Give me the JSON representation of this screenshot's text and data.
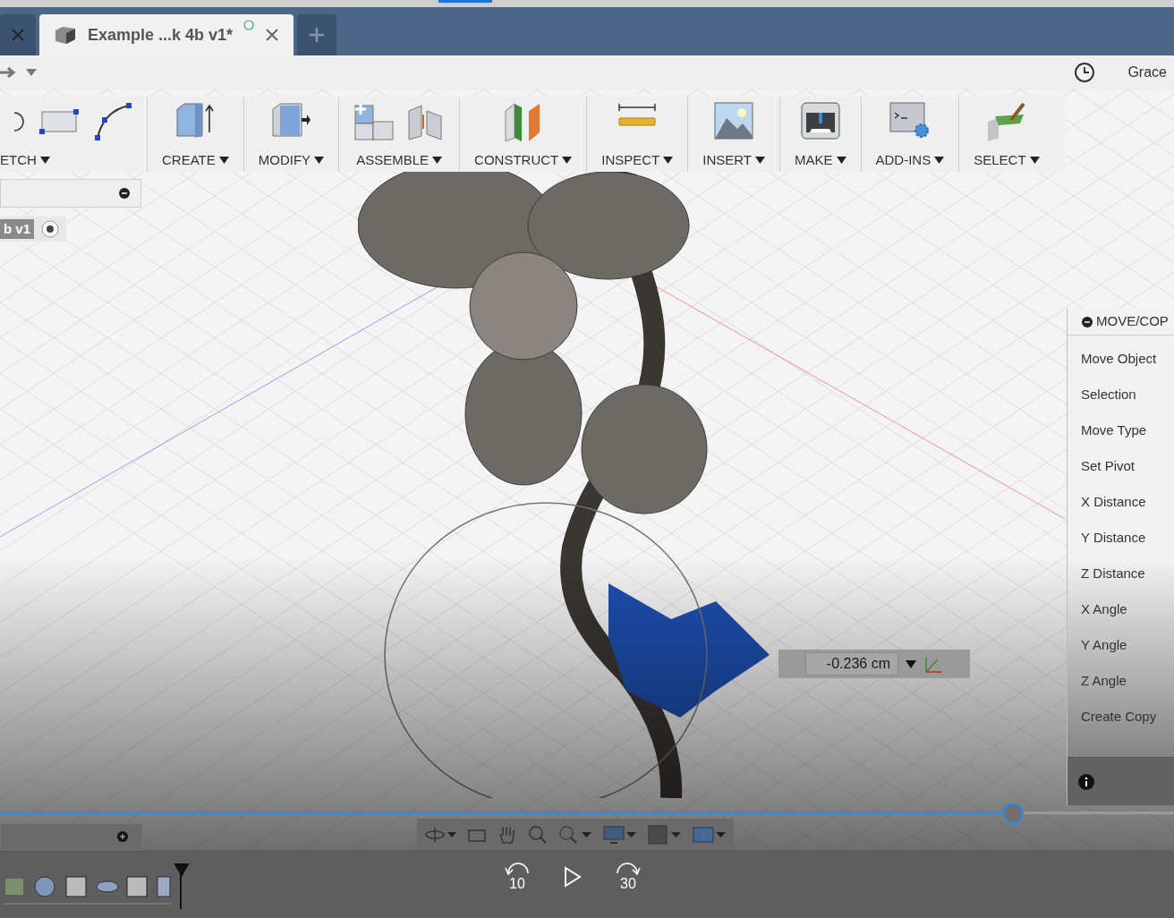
{
  "tabs": [
    {
      "selected": false
    },
    {
      "label": "Example ...k 4b v1*",
      "selected": true
    }
  ],
  "user": {
    "name": "Grace"
  },
  "toolbar": [
    {
      "label": "ETCH",
      "kind": "sketch"
    },
    {
      "label": "CREATE",
      "kind": "create"
    },
    {
      "label": "MODIFY",
      "kind": "modify"
    },
    {
      "label": "ASSEMBLE",
      "kind": "assemble"
    },
    {
      "label": "CONSTRUCT",
      "kind": "construct"
    },
    {
      "label": "INSPECT",
      "kind": "inspect"
    },
    {
      "label": "INSERT",
      "kind": "insert"
    },
    {
      "label": "MAKE",
      "kind": "make"
    },
    {
      "label": "ADD-INS",
      "kind": "addins"
    },
    {
      "label": "SELECT",
      "kind": "select"
    }
  ],
  "browser": {
    "root": "b v1"
  },
  "dimension_input": {
    "value": "-0.236 cm"
  },
  "move_panel": {
    "title": "MOVE/COP",
    "rows": [
      "Move Object",
      "Selection",
      "Move Type",
      "Set Pivot",
      "X Distance",
      "Y Distance",
      "Z Distance",
      "X Angle",
      "Y Angle",
      "Z Angle",
      "Create Copy"
    ]
  },
  "player": {
    "level": 0.863,
    "skip_back": "10",
    "skip_forward": "30"
  }
}
